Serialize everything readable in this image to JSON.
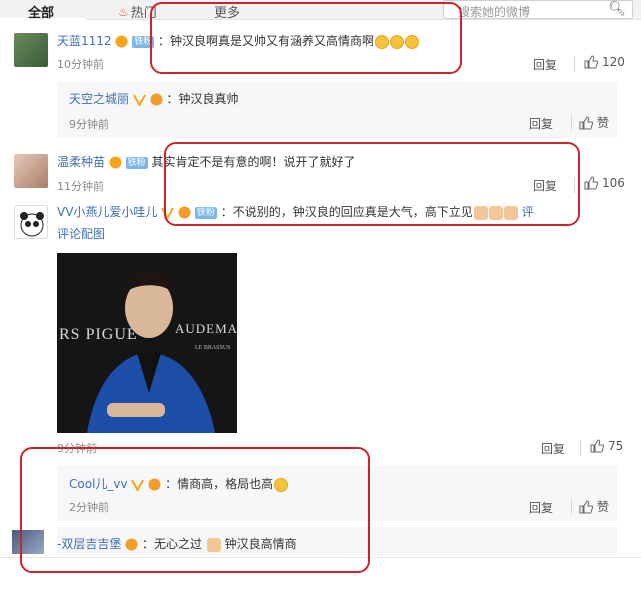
{
  "tabs": {
    "all": "全部",
    "hot": "热门",
    "more": "更多"
  },
  "search": {
    "placeholder": "搜索她的微博"
  },
  "labels": {
    "reply": "回复",
    "like": "赞",
    "badge_fan": "铁粉"
  },
  "comments": [
    {
      "user": "天蓝1112",
      "text": "：钟汉良啊真是又帅又有涵养又高情商啊",
      "time": "10分钟前",
      "likes": "120",
      "reply": {
        "user": "天空之城丽",
        "text": "：钟汉良真帅",
        "time": "9分钟前"
      }
    },
    {
      "user": "温柔种苗",
      "text": "其实肯定不是有意的啊！说开了就好了",
      "time": "11分钟前",
      "likes": "106"
    },
    {
      "user": "VV小燕儿爱小哇儿",
      "text": "：不说别的，钟汉良的回应真是大气，高下立见",
      "view_pic": "评论配图",
      "pic_view_short": "评",
      "time": "9分钟前",
      "likes": "75",
      "photo_text_left": "RS PIGUE",
      "photo_text_right": "AUDEMARS",
      "photo_text_small": "LE BRASSUS",
      "reply": {
        "user": "Cool儿_vv",
        "text": "：情商高，格局也高",
        "time": "2分钟前"
      }
    },
    {
      "user": "-双层吉吉堡",
      "text": "：无心之过",
      "text2": "钟汉良高情商"
    }
  ],
  "colors": {
    "highlight": "#c8262a",
    "name": "#eb7350",
    "link": "#3d6fb4"
  }
}
